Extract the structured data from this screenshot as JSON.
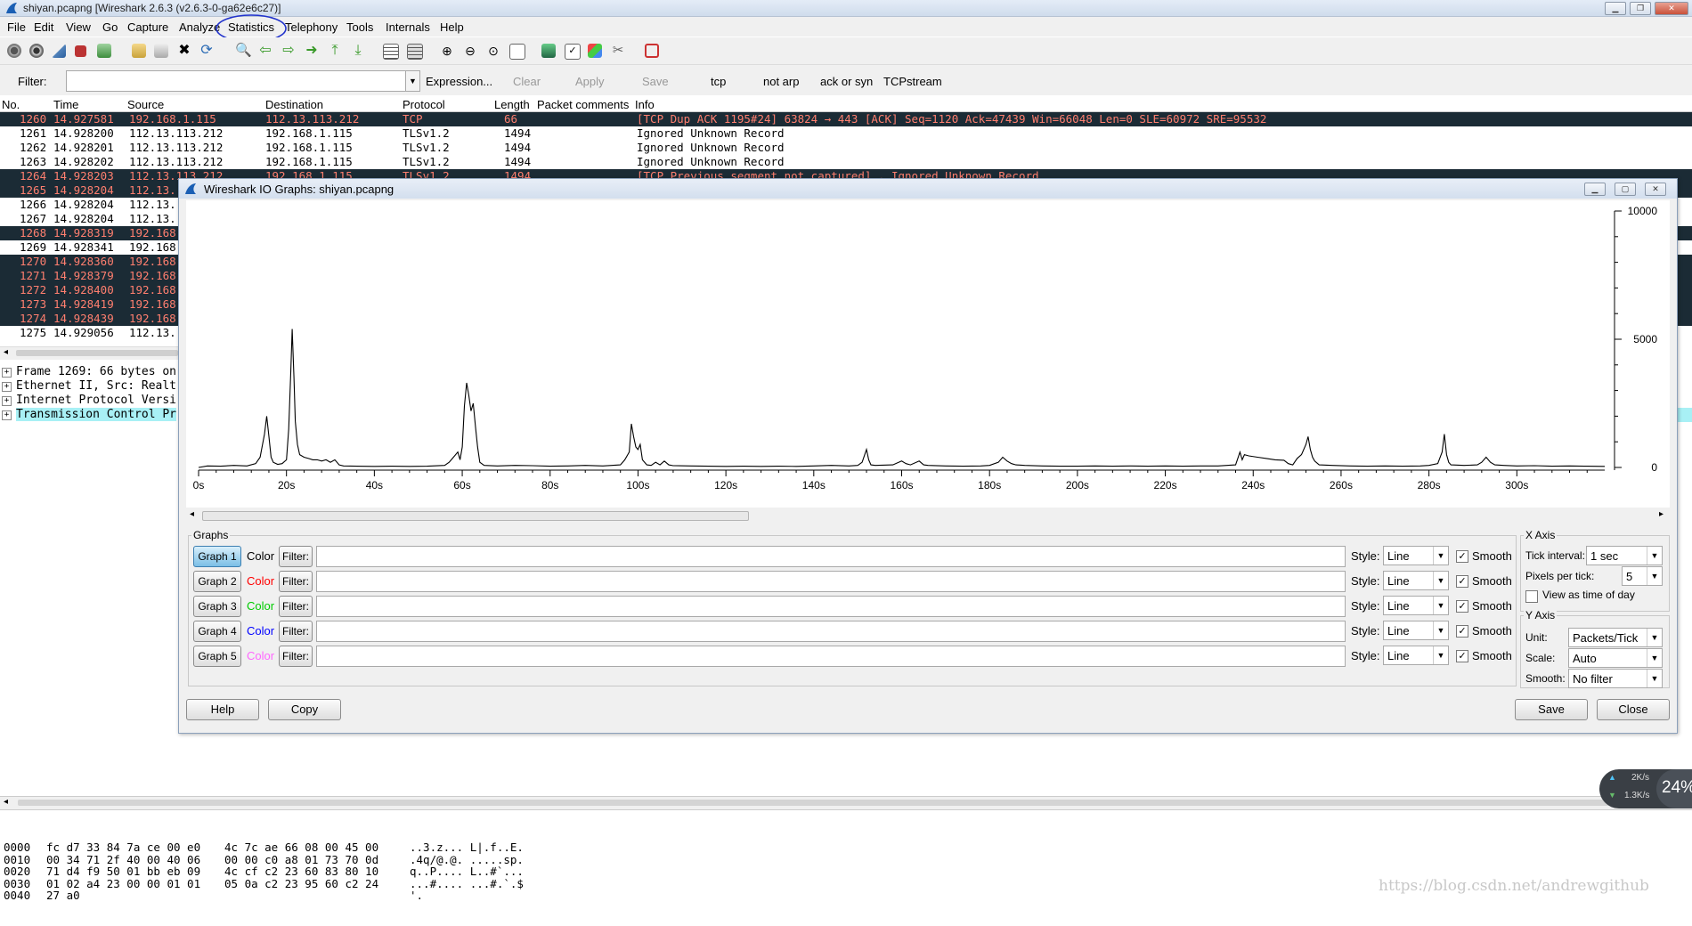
{
  "window": {
    "title": "shiyan.pcapng [Wireshark 2.6.3 (v2.6.3-0-ga62e6c27)]"
  },
  "menu": [
    "File",
    "Edit",
    "View",
    "Go",
    "Capture",
    "Analyze",
    "Statistics",
    "Telephony",
    "Tools",
    "Internals",
    "Help"
  ],
  "filter_bar": {
    "label": "Filter:",
    "value": "",
    "expression": "Expression...",
    "clear": "Clear",
    "apply": "Apply",
    "save": "Save",
    "shortcuts": [
      "tcp",
      "not arp",
      "ack or syn",
      "TCPstream"
    ]
  },
  "packet_list": {
    "columns": [
      "No.",
      "Time",
      "Source",
      "Destination",
      "Protocol",
      "Length",
      "Packet comments",
      "Info"
    ],
    "rows": [
      {
        "no": "1260",
        "time": "14.927581",
        "src": "192.168.1.115",
        "dst": "112.13.113.212",
        "proto": "TCP",
        "len": "66",
        "info": "[TCP Dup ACK 1195#24] 63824 → 443 [ACK] Seq=1120 Ack=47439 Win=66048 Len=0 SLE=60972 SRE=95532",
        "style": "dark"
      },
      {
        "no": "1261",
        "time": "14.928200",
        "src": "112.13.113.212",
        "dst": "192.168.1.115",
        "proto": "TLSv1.2",
        "len": "1494",
        "info": "Ignored Unknown Record",
        "style": "light"
      },
      {
        "no": "1262",
        "time": "14.928201",
        "src": "112.13.113.212",
        "dst": "192.168.1.115",
        "proto": "TLSv1.2",
        "len": "1494",
        "info": "Ignored Unknown Record",
        "style": "light"
      },
      {
        "no": "1263",
        "time": "14.928202",
        "src": "112.13.113.212",
        "dst": "192.168.1.115",
        "proto": "TLSv1.2",
        "len": "1494",
        "info": "Ignored Unknown Record",
        "style": "light"
      },
      {
        "no": "1264",
        "time": "14.928203",
        "src": "112.13.113.212",
        "dst": "192.168.1.115",
        "proto": "TLSv1.2",
        "len": "1494",
        "info": "[TCP Previous segment not captured] , Ignored Unknown Record",
        "style": "dark"
      },
      {
        "no": "1265",
        "time": "14.928204",
        "src": "112.13.",
        "dst": "",
        "proto": "",
        "len": "",
        "info": "",
        "style": "dark"
      },
      {
        "no": "1266",
        "time": "14.928204",
        "src": "112.13.",
        "dst": "",
        "proto": "",
        "len": "",
        "info": "",
        "style": "light"
      },
      {
        "no": "1267",
        "time": "14.928204",
        "src": "112.13.",
        "dst": "",
        "proto": "",
        "len": "",
        "info": "",
        "style": "light"
      },
      {
        "no": "1268",
        "time": "14.928319",
        "src": "192.168",
        "dst": "",
        "proto": "",
        "len": "",
        "info": "",
        "style": "dark"
      },
      {
        "no": "1269",
        "time": "14.928341",
        "src": "192.168",
        "dst": "",
        "proto": "",
        "len": "",
        "info": "",
        "style": "light"
      },
      {
        "no": "1270",
        "time": "14.928360",
        "src": "192.168",
        "dst": "",
        "proto": "",
        "len": "",
        "info": "",
        "style": "dark"
      },
      {
        "no": "1271",
        "time": "14.928379",
        "src": "192.168",
        "dst": "",
        "proto": "",
        "len": "",
        "info": "",
        "style": "dark"
      },
      {
        "no": "1272",
        "time": "14.928400",
        "src": "192.168",
        "dst": "",
        "proto": "",
        "len": "",
        "info": "",
        "style": "dark"
      },
      {
        "no": "1273",
        "time": "14.928419",
        "src": "192.168",
        "dst": "",
        "proto": "",
        "len": "",
        "info": "",
        "style": "dark"
      },
      {
        "no": "1274",
        "time": "14.928439",
        "src": "192.168",
        "dst": "",
        "proto": "",
        "len": "",
        "info": "",
        "style": "dark"
      },
      {
        "no": "1275",
        "time": "14.929056",
        "src": "112.13.",
        "dst": "",
        "proto": "",
        "len": "",
        "info": "",
        "style": "light"
      }
    ]
  },
  "details": [
    "Frame 1269: 66 bytes on",
    "Ethernet II, Src: Realt",
    "Internet Protocol Versi",
    "Transmission Control Pr"
  ],
  "bytes": {
    "offsets": [
      "0000",
      "0010",
      "0020",
      "0030",
      "0040"
    ],
    "hex1": [
      "fc d7 33 84 7a ce 00 e0",
      "00 34 71 2f 40 00 40 06",
      "71 d4 f9 50 01 bb eb 09",
      "01 02 a4 23 00 00 01 01",
      "27 a0"
    ],
    "hex2": [
      "4c 7c ae 66 08 00 45 00",
      "00 00 c0 a8 01 73 70 0d",
      "4c cf c2 23 60 83 80 10",
      "05 0a c2 23 95 60 c2 24",
      ""
    ],
    "ascii": [
      "..3.z... L|.f..E.",
      ".4q/@.@. .....sp.",
      "q..P.... L..#`...",
      "...#.... ...#.`.$",
      "'."
    ]
  },
  "net_widget": {
    "up": "2K/s",
    "down": "1.3K/s",
    "percent": "24%"
  },
  "watermark": "https://blog.csdn.net/andrewgithub",
  "dialog": {
    "title": "Wireshark IO Graphs: shiyan.pcapng",
    "graphs_label": "Graphs",
    "graphs": [
      {
        "button": "Graph 1",
        "color_label": "Color",
        "color": "#000000",
        "filter_btn": "Filter:",
        "filter": "",
        "style": "Line",
        "smooth_label": "Smooth",
        "smooth": true
      },
      {
        "button": "Graph 2",
        "color_label": "Color",
        "color": "#ff0000",
        "filter_btn": "Filter:",
        "filter": "",
        "style": "Line",
        "smooth_label": "Smooth",
        "smooth": true
      },
      {
        "button": "Graph 3",
        "color_label": "Color",
        "color": "#00cc00",
        "filter_btn": "Filter:",
        "filter": "",
        "style": "Line",
        "smooth_label": "Smooth",
        "smooth": true
      },
      {
        "button": "Graph 4",
        "color_label": "Color",
        "color": "#0000ff",
        "filter_btn": "Filter:",
        "filter": "",
        "style": "Line",
        "smooth_label": "Smooth",
        "smooth": true
      },
      {
        "button": "Graph 5",
        "color_label": "Color",
        "color": "#ff66ff",
        "filter_btn": "Filter:",
        "filter": "",
        "style": "Line",
        "smooth_label": "Smooth",
        "smooth": true
      }
    ],
    "style_label": "Style:",
    "x_axis": {
      "label": "X Axis",
      "tick_interval_label": "Tick interval:",
      "tick_interval": "1 sec",
      "pixels_per_tick_label": "Pixels per tick:",
      "pixels_per_tick": "5",
      "time_of_day_label": "View as time of day",
      "time_of_day": false
    },
    "y_axis": {
      "label": "Y Axis",
      "unit_label": "Unit:",
      "unit": "Packets/Tick",
      "scale_label": "Scale:",
      "scale": "Auto",
      "smooth_label": "Smooth:",
      "smooth": "No filter"
    },
    "buttons": {
      "help": "Help",
      "copy": "Copy",
      "save": "Save",
      "close": "Close"
    }
  },
  "chart_data": {
    "type": "line",
    "xlabel": "",
    "ylabel": "",
    "x_ticks": [
      "0s",
      "20s",
      "40s",
      "60s",
      "80s",
      "100s",
      "120s",
      "140s",
      "160s",
      "180s",
      "200s",
      "220s",
      "240s",
      "260s",
      "280s",
      "300s"
    ],
    "y_ticks": [
      "10000",
      "5000",
      "0"
    ],
    "xlim": [
      0,
      320
    ],
    "ylim": [
      0,
      10000
    ],
    "series": [
      {
        "color": "#000000",
        "points": [
          [
            0,
            0
          ],
          [
            2,
            60
          ],
          [
            5,
            50
          ],
          [
            8,
            80
          ],
          [
            11,
            60
          ],
          [
            13,
            150
          ],
          [
            14,
            400
          ],
          [
            15,
            1300
          ],
          [
            15.5,
            2000
          ],
          [
            16,
            1200
          ],
          [
            16.5,
            400
          ],
          [
            17,
            200
          ],
          [
            18,
            120
          ],
          [
            19,
            150
          ],
          [
            20,
            300
          ],
          [
            20.5,
            1500
          ],
          [
            21,
            3800
          ],
          [
            21.3,
            5400
          ],
          [
            21.7,
            3500
          ],
          [
            22,
            1800
          ],
          [
            22.5,
            900
          ],
          [
            23,
            500
          ],
          [
            24,
            400
          ],
          [
            25,
            350
          ],
          [
            26,
            300
          ],
          [
            27,
            300
          ],
          [
            28,
            250
          ],
          [
            29,
            300
          ],
          [
            30,
            200
          ],
          [
            31,
            300
          ],
          [
            32,
            100
          ],
          [
            33,
            60
          ],
          [
            36,
            50
          ],
          [
            40,
            40
          ],
          [
            44,
            50
          ],
          [
            48,
            40
          ],
          [
            52,
            50
          ],
          [
            56,
            80
          ],
          [
            57,
            200
          ],
          [
            58,
            400
          ],
          [
            59,
            600
          ],
          [
            59.5,
            300
          ],
          [
            60,
            800
          ],
          [
            60.5,
            2400
          ],
          [
            61,
            3300
          ],
          [
            61.5,
            2800
          ],
          [
            62,
            2200
          ],
          [
            62.5,
            2500
          ],
          [
            63,
            1600
          ],
          [
            63.5,
            800
          ],
          [
            64,
            200
          ],
          [
            65,
            80
          ],
          [
            68,
            60
          ],
          [
            72,
            80
          ],
          [
            76,
            70
          ],
          [
            80,
            50
          ],
          [
            84,
            60
          ],
          [
            88,
            80
          ],
          [
            92,
            60
          ],
          [
            96,
            100
          ],
          [
            97,
            300
          ],
          [
            98,
            600
          ],
          [
            98.5,
            1700
          ],
          [
            99,
            1200
          ],
          [
            99.5,
            800
          ],
          [
            100,
            700
          ],
          [
            100.5,
            900
          ],
          [
            101,
            300
          ],
          [
            102,
            100
          ],
          [
            103,
            80
          ],
          [
            104,
            200
          ],
          [
            105,
            100
          ],
          [
            106,
            250
          ],
          [
            107,
            100
          ],
          [
            108,
            70
          ],
          [
            112,
            60
          ],
          [
            116,
            50
          ],
          [
            120,
            40
          ],
          [
            124,
            50
          ],
          [
            128,
            40
          ],
          [
            132,
            50
          ],
          [
            136,
            40
          ],
          [
            140,
            60
          ],
          [
            144,
            80
          ],
          [
            148,
            60
          ],
          [
            150,
            80
          ],
          [
            151,
            200
          ],
          [
            152,
            700
          ],
          [
            152.5,
            300
          ],
          [
            153,
            100
          ],
          [
            154,
            80
          ],
          [
            158,
            100
          ],
          [
            160,
            250
          ],
          [
            161,
            150
          ],
          [
            162,
            100
          ],
          [
            164,
            250
          ],
          [
            165,
            100
          ],
          [
            166,
            80
          ],
          [
            170,
            60
          ],
          [
            174,
            50
          ],
          [
            178,
            60
          ],
          [
            180,
            80
          ],
          [
            182,
            200
          ],
          [
            183,
            400
          ],
          [
            184,
            250
          ],
          [
            185,
            150
          ],
          [
            186,
            100
          ],
          [
            188,
            80
          ],
          [
            192,
            60
          ],
          [
            196,
            50
          ],
          [
            200,
            50
          ],
          [
            204,
            60
          ],
          [
            208,
            50
          ],
          [
            212,
            60
          ],
          [
            216,
            50
          ],
          [
            220,
            60
          ],
          [
            224,
            50
          ],
          [
            228,
            60
          ],
          [
            232,
            60
          ],
          [
            234,
            80
          ],
          [
            236,
            100
          ],
          [
            237,
            600
          ],
          [
            237.5,
            300
          ],
          [
            238,
            500
          ],
          [
            239,
            450
          ],
          [
            241,
            400
          ],
          [
            243,
            350
          ],
          [
            245,
            300
          ],
          [
            247,
            280
          ],
          [
            248,
            150
          ],
          [
            249,
            100
          ],
          [
            250,
            350
          ],
          [
            251,
            500
          ],
          [
            252,
            900
          ],
          [
            252.5,
            1200
          ],
          [
            253,
            700
          ],
          [
            253.5,
            400
          ],
          [
            254,
            250
          ],
          [
            255,
            100
          ],
          [
            258,
            80
          ],
          [
            262,
            60
          ],
          [
            266,
            50
          ],
          [
            270,
            60
          ],
          [
            274,
            50
          ],
          [
            278,
            60
          ],
          [
            280,
            80
          ],
          [
            282,
            150
          ],
          [
            283,
            600
          ],
          [
            283.5,
            1300
          ],
          [
            284,
            500
          ],
          [
            284.5,
            200
          ],
          [
            285,
            100
          ],
          [
            288,
            80
          ],
          [
            291,
            100
          ],
          [
            292,
            200
          ],
          [
            293,
            400
          ],
          [
            294,
            200
          ],
          [
            295,
            100
          ],
          [
            297,
            80
          ],
          [
            300,
            60
          ],
          [
            304,
            70
          ],
          [
            308,
            50
          ],
          [
            312,
            60
          ],
          [
            316,
            50
          ],
          [
            320,
            40
          ]
        ]
      }
    ]
  }
}
